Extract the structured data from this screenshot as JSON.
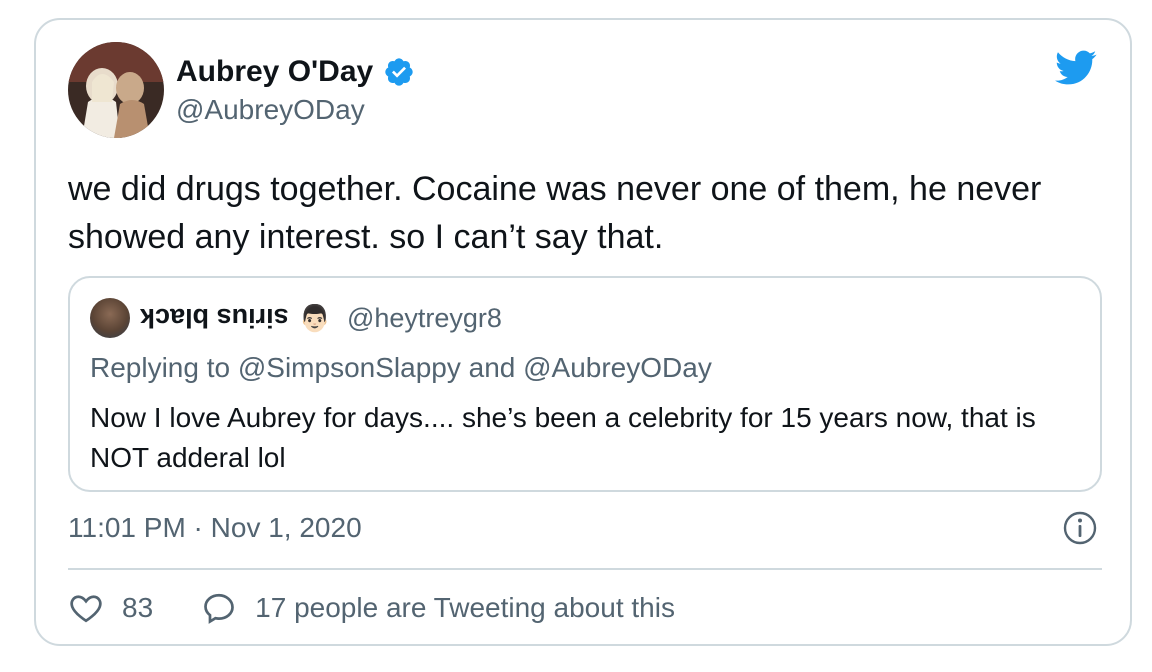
{
  "author": {
    "display_name": "Aubrey O'Day",
    "handle": "@AubreyODay",
    "verified_color": "#1d9bf0"
  },
  "tweet": {
    "text": "we did drugs together. Cocaine was never one of them, he never showed any interest. so I can’t say that.",
    "timestamp": "11:01 PM · Nov 1, 2020"
  },
  "quoted": {
    "display_name": "sirius black",
    "emoji": "👨🏻",
    "handle": "@heytreygr8",
    "replying_to": "Replying to @SimpsonSlappy and @AubreyODay",
    "text": "Now I love Aubrey for days.... she’s been a celebrity for 15 years now, that is NOT adderal lol"
  },
  "actions": {
    "likes": "83",
    "tweeting": "17 people are Tweeting about this"
  },
  "icons": {
    "brand": "twitter-bird-icon",
    "verified": "verified-badge-icon",
    "info": "info-icon",
    "like": "heart-icon",
    "reply": "speech-bubble-icon"
  },
  "colors": {
    "brand_blue": "#1d9bf0",
    "secondary_text": "#536471",
    "border": "#cfd9de"
  }
}
